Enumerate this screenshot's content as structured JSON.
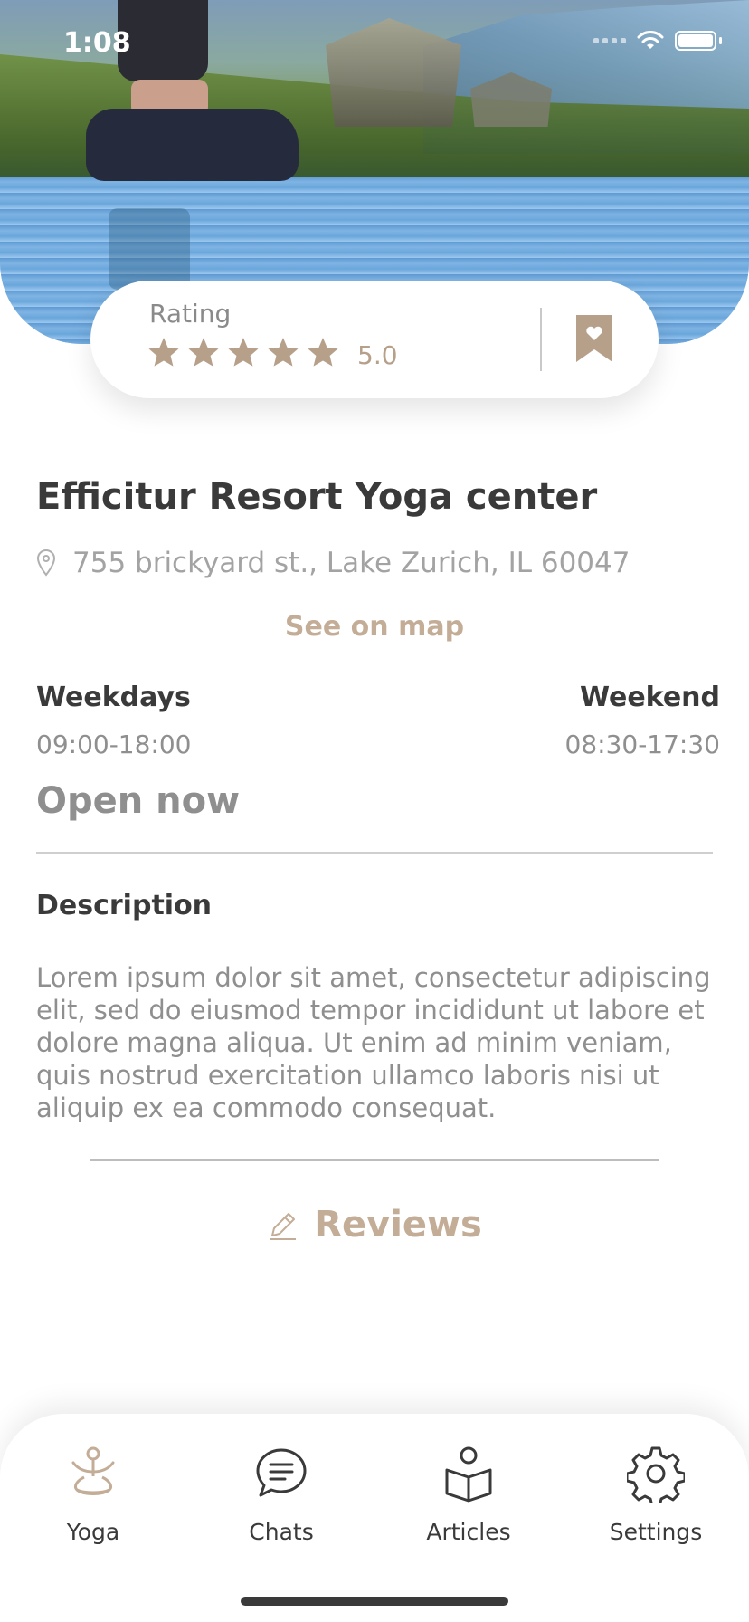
{
  "status_bar": {
    "time": "1:08"
  },
  "rating": {
    "label": "Rating",
    "value": "5.0",
    "stars": 5
  },
  "place": {
    "title": "Efficitur Resort Yoga center",
    "address": "755 brickyard st., Lake Zurich, IL 60047",
    "see_on_map": "See on map"
  },
  "hours": {
    "weekdays_label": "Weekdays",
    "weekdays_time": "09:00-18:00",
    "weekend_label": "Weekend",
    "weekend_time": "08:30-17:30",
    "status": "Open now"
  },
  "description": {
    "heading": "Description",
    "body": "Lorem ipsum dolor sit amet, consectetur adipiscing elit, sed do eiusmod tempor incididunt ut labore et dolore magna aliqua. Ut enim ad minim veniam, quis nostrud exercitation ullamco laboris nisi ut aliquip ex ea commodo consequat."
  },
  "reviews": {
    "label": "Reviews"
  },
  "tabbar": {
    "items": [
      {
        "label": "Yoga",
        "icon": "yoga-icon",
        "active": true
      },
      {
        "label": "Chats",
        "icon": "chat-icon",
        "active": false
      },
      {
        "label": "Articles",
        "icon": "articles-icon",
        "active": false
      },
      {
        "label": "Settings",
        "icon": "gear-icon",
        "active": false
      }
    ]
  },
  "colors": {
    "accent": "#c4ad97",
    "star": "#b7a08a",
    "text_dark": "#3a3a3a",
    "text_muted": "#8f8f8f"
  }
}
